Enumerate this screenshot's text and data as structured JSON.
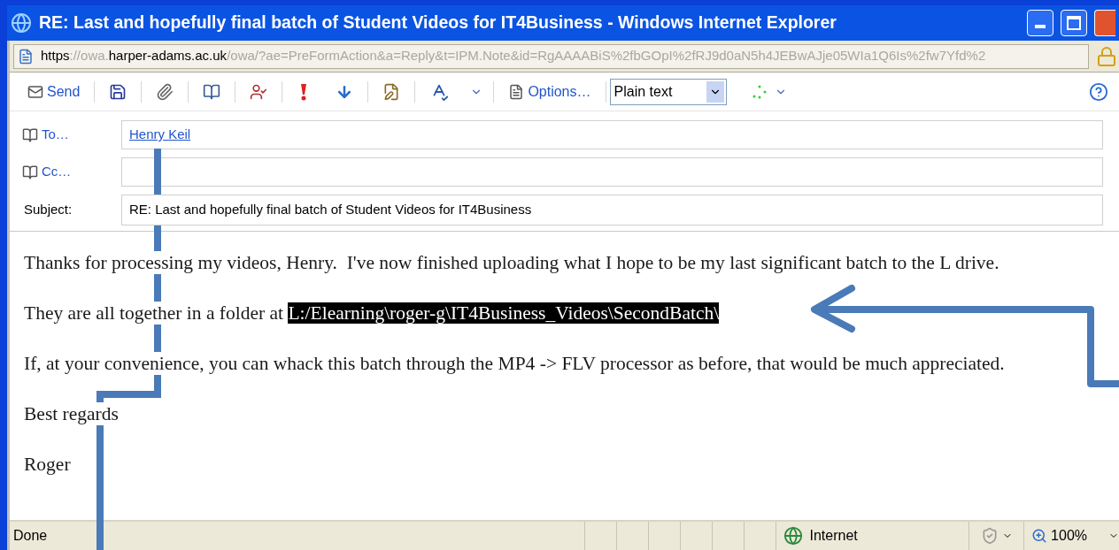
{
  "window": {
    "title": "RE: Last and hopefully final batch of Student Videos for IT4Business - Windows Internet Explorer"
  },
  "address_bar": {
    "parts": [
      {
        "text": "https",
        "dim": false
      },
      {
        "text": "://owa.",
        "dim": true
      },
      {
        "text": "harper-adams.ac.uk",
        "dim": false
      },
      {
        "text": "/owa/?ae=PreFormAction&a=Reply&t=IPM.Note&id=RgAAAABiS%2fbGOpI%2fRJ9d0aN5h4JEBwAJje05WIa1Q6Is%2fw7Yfd%2",
        "dim": true
      }
    ]
  },
  "toolbar": {
    "send": "Send",
    "options": "Options…",
    "format": "Plain text"
  },
  "compose": {
    "to": {
      "label": "To…",
      "recipients": [
        "Henry Keil"
      ]
    },
    "cc": {
      "label": "Cc…"
    },
    "subject": {
      "label": "Subject:",
      "value": "RE: Last and hopefully final batch of Student Videos for IT4Business"
    }
  },
  "body": {
    "paragraphs": [
      [
        {
          "text": "Thanks for processing my videos, Henry.  I've now finished uploading what I hope to be my last significant batch to the L drive.",
          "highlighted": false
        }
      ],
      [
        {
          "text": "They are all together in a folder at ",
          "highlighted": false
        },
        {
          "text": "L:/Elearning\\roger-g\\IT4Business_Videos\\SecondBatch\\",
          "highlighted": true
        }
      ],
      [
        {
          "text": "If, at your convenience, you can whack this batch through the MP4 -> FLV processor as before, that would be much appreciated.",
          "highlighted": false
        }
      ],
      [
        {
          "text": "Best regards",
          "highlighted": false
        }
      ],
      [
        {
          "text": "Roger",
          "highlighted": false
        }
      ]
    ]
  },
  "status_bar": {
    "text": "Done",
    "zone": "Internet",
    "zoom": "100%"
  }
}
